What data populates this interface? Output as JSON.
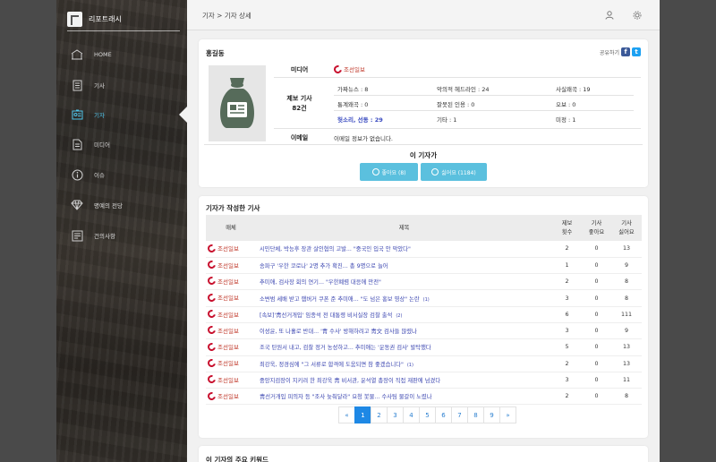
{
  "app": {
    "name": "리포트래시"
  },
  "sidebar": {
    "items": [
      {
        "label": "HOME",
        "icon": "home-icon"
      },
      {
        "label": "기사",
        "icon": "article-icon"
      },
      {
        "label": "기자",
        "icon": "reporter-id-icon",
        "active": true
      },
      {
        "label": "미디어",
        "icon": "media-doc-icon"
      },
      {
        "label": "이슈",
        "icon": "info-icon"
      },
      {
        "label": "명예의 전당",
        "icon": "diamond-icon"
      },
      {
        "label": "건의사항",
        "icon": "suggestion-icon"
      }
    ]
  },
  "breadcrumb": "기자 > 기자 상세",
  "reporter": {
    "name": "홍길동",
    "share_label": "공유하기",
    "media_label": "미디어",
    "media_name": "조선일보",
    "report_label": "제보 기사",
    "report_count": "82건",
    "stats": [
      {
        "label": "가짜뉴스 : 8"
      },
      {
        "label": "악의적 헤드라인 : 24"
      },
      {
        "label": "사실왜곡 : 19"
      },
      {
        "label": "통계왜곡 : 0"
      },
      {
        "label": "잘못된 인용 : 0"
      },
      {
        "label": "오보 : 0"
      },
      {
        "label": "헛소리, 선동 : 29"
      },
      {
        "label": "기타 : 1"
      },
      {
        "label": "미정 : 1"
      }
    ],
    "email_label": "이메일",
    "email_value": "이메일 정보가 없습니다.",
    "like_title": "이 기자가",
    "like_button": "좋아요 (8)",
    "dislike_button": "싫어요 (1184)"
  },
  "articles": {
    "title": "기자가 작성한 기사",
    "columns": {
      "media": "매체",
      "title": "제목",
      "reports": "제보\n횟수",
      "likes": "기사\n좋아요",
      "dislikes": "기사\n싫어요"
    },
    "rows": [
      {
        "media": "조선일보",
        "title": "시민단체, 박능후 장관 살인혐의 고발... \"중국인 입국 안 막았다\"",
        "count": "",
        "reports": "2",
        "likes": "0",
        "dislikes": "13"
      },
      {
        "media": "조선일보",
        "title": "송파구 '우한 코로나' 2명 추가 확진... 총 9명으로 늘어",
        "count": "",
        "reports": "1",
        "likes": "0",
        "dislikes": "9"
      },
      {
        "media": "조선일보",
        "title": "추미애, 검사장 회의 연기... \"우한폐렴 대응에 만전\"",
        "count": "",
        "reports": "2",
        "likes": "0",
        "dislikes": "8"
      },
      {
        "media": "조선일보",
        "title": "소변범 세배 받고 햄버거 쿠폰 준 추미애... \"도 넘은 홍보 영상\" 논란",
        "count": "(1)",
        "reports": "3",
        "likes": "0",
        "dislikes": "8"
      },
      {
        "media": "조선일보",
        "title": "[속보]'靑선거개입' 임종석 전 대통령 비서실장 검찰 출석",
        "count": "(2)",
        "reports": "6",
        "likes": "0",
        "dislikes": "111"
      },
      {
        "media": "조선일보",
        "title": "이성윤, 또 나홀로 반대... '靑 수사' 방해하려고 靑文 검사들 많렸나",
        "count": "",
        "reports": "3",
        "likes": "0",
        "dislikes": "9"
      },
      {
        "media": "조선일보",
        "title": "조국 탄원서 내고, 검찰 정거 농성하고... 추미애는 '운동권 검사' 발탁했다",
        "count": "",
        "reports": "5",
        "likes": "0",
        "dislikes": "13"
      },
      {
        "media": "조선일보",
        "title": "최강욱, 정경심에 \"그 서류로 합격에 도움되면 참 좋겠습니다\"",
        "count": "(1)",
        "reports": "2",
        "likes": "0",
        "dislikes": "13"
      },
      {
        "media": "조선일보",
        "title": "중앙지검장이 지키려 한 최강욱 靑 비서관, 윤석열 총장이 직접 재판에 넘겼다",
        "count": "",
        "reports": "3",
        "likes": "0",
        "dislikes": "11"
      },
      {
        "media": "조선일보",
        "title": "靑선거개입 피의자 등 \"조사 늦춰달라\" 요청 봇물... 수사팀 물갈이 노렸나",
        "count": "",
        "reports": "2",
        "likes": "0",
        "dislikes": "8"
      }
    ]
  },
  "pager": {
    "prev": "«",
    "pages": [
      "1",
      "2",
      "3",
      "4",
      "5",
      "6",
      "7",
      "8",
      "9"
    ],
    "next": "»",
    "current": "1"
  },
  "keywords": {
    "title": "이 기자의 주요 키워드"
  },
  "colors": {
    "accent": "#5bc0de",
    "active_nav": "#4fc3e8",
    "link": "#3a45b0",
    "media_red": "#c8102e",
    "page_active": "#1e88e5"
  }
}
